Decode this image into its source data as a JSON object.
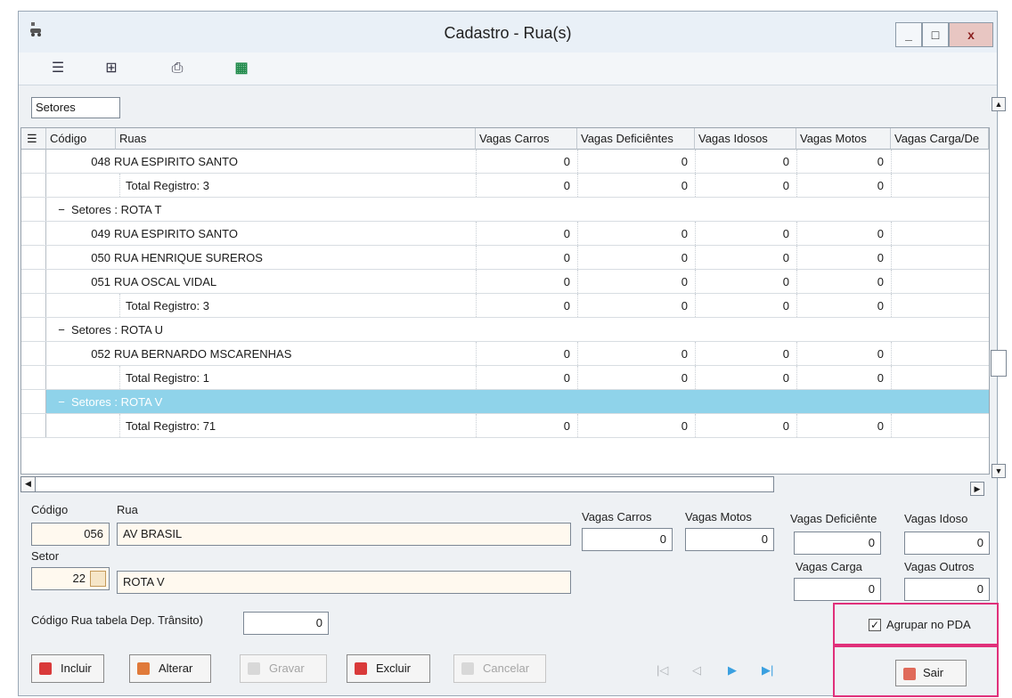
{
  "window": {
    "title": "Cadastro - Rua(s)",
    "minimize": "_",
    "maximize": "□",
    "close": "x"
  },
  "toolbar": {
    "icons": [
      "list-icon",
      "tree-icon",
      "print-icon",
      "excel-icon"
    ]
  },
  "grouping": {
    "label": "Setores"
  },
  "grid": {
    "columns": [
      "Código",
      "Ruas",
      "Vagas Carros",
      "Vagas Deficiêntes",
      "Vagas Idosos",
      "Vagas Motos",
      "Vagas Carga/De"
    ],
    "rows": [
      {
        "type": "data",
        "codigo": "048",
        "rua": "RUA ESPIRITO SANTO",
        "v": [
          "0",
          "0",
          "0",
          "0",
          ""
        ]
      },
      {
        "type": "total",
        "label": "Total Registro: 3",
        "v": [
          "0",
          "0",
          "0",
          "0",
          ""
        ]
      },
      {
        "type": "group",
        "label": "Setores : ROTA T",
        "toggle": "−"
      },
      {
        "type": "data",
        "codigo": "049",
        "rua": "RUA ESPIRITO SANTO",
        "v": [
          "0",
          "0",
          "0",
          "0",
          ""
        ]
      },
      {
        "type": "data",
        "codigo": "050",
        "rua": "RUA HENRIQUE SUREROS",
        "v": [
          "0",
          "0",
          "0",
          "0",
          ""
        ]
      },
      {
        "type": "data",
        "codigo": "051",
        "rua": "RUA OSCAL VIDAL",
        "v": [
          "0",
          "0",
          "0",
          "0",
          ""
        ]
      },
      {
        "type": "total",
        "label": "Total Registro: 3",
        "v": [
          "0",
          "0",
          "0",
          "0",
          ""
        ]
      },
      {
        "type": "group",
        "label": "Setores : ROTA U",
        "toggle": "−"
      },
      {
        "type": "data",
        "codigo": "052",
        "rua": "RUA BERNARDO MSCARENHAS",
        "v": [
          "0",
          "0",
          "0",
          "0",
          ""
        ]
      },
      {
        "type": "total",
        "label": "Total Registro: 1",
        "v": [
          "0",
          "0",
          "0",
          "0",
          ""
        ]
      },
      {
        "type": "group",
        "label": "Setores : ROTA V",
        "toggle": "−",
        "selected": true,
        "pointer": "▶"
      },
      {
        "type": "total",
        "label": "Total Registro: 71",
        "v": [
          "0",
          "0",
          "0",
          "0",
          ""
        ]
      }
    ]
  },
  "form": {
    "codigo_label": "Código",
    "codigo": "056",
    "rua_label": "Rua",
    "rua": "AV BRASIL",
    "setor_label": "Setor",
    "setor_code": "22",
    "setor_name": "ROTA V",
    "vagas_carros_label": "Vagas Carros",
    "vagas_carros": "0",
    "vagas_motos_label": "Vagas Motos",
    "vagas_motos": "0",
    "vagas_deficiente_label": "Vagas Deficiênte",
    "vagas_deficiente": "0",
    "vagas_idoso_label": "Vagas Idoso",
    "vagas_idoso": "0",
    "vagas_carga_label": "Vagas Carga",
    "vagas_carga": "0",
    "vagas_outros_label": "Vagas Outros",
    "vagas_outros": "0",
    "dep_transito_label": "Código Rua tabela Dep. Trânsito)",
    "dep_transito": "0",
    "agrupar_label": "Agrupar no PDA"
  },
  "buttons": {
    "incluir": "Incluir",
    "alterar": "Alterar",
    "gravar": "Gravar",
    "excluir": "Excluir",
    "cancelar": "Cancelar",
    "sair": "Sair"
  },
  "nav": {
    "first": "|◁",
    "prev": "◁",
    "next": "▶",
    "last": "▶|"
  },
  "colors": {
    "selected_row": "#8fd3ea",
    "highlight_frame": "#e0307a",
    "btn_red": "#d93a3a",
    "btn_orange": "#e07a3a"
  }
}
